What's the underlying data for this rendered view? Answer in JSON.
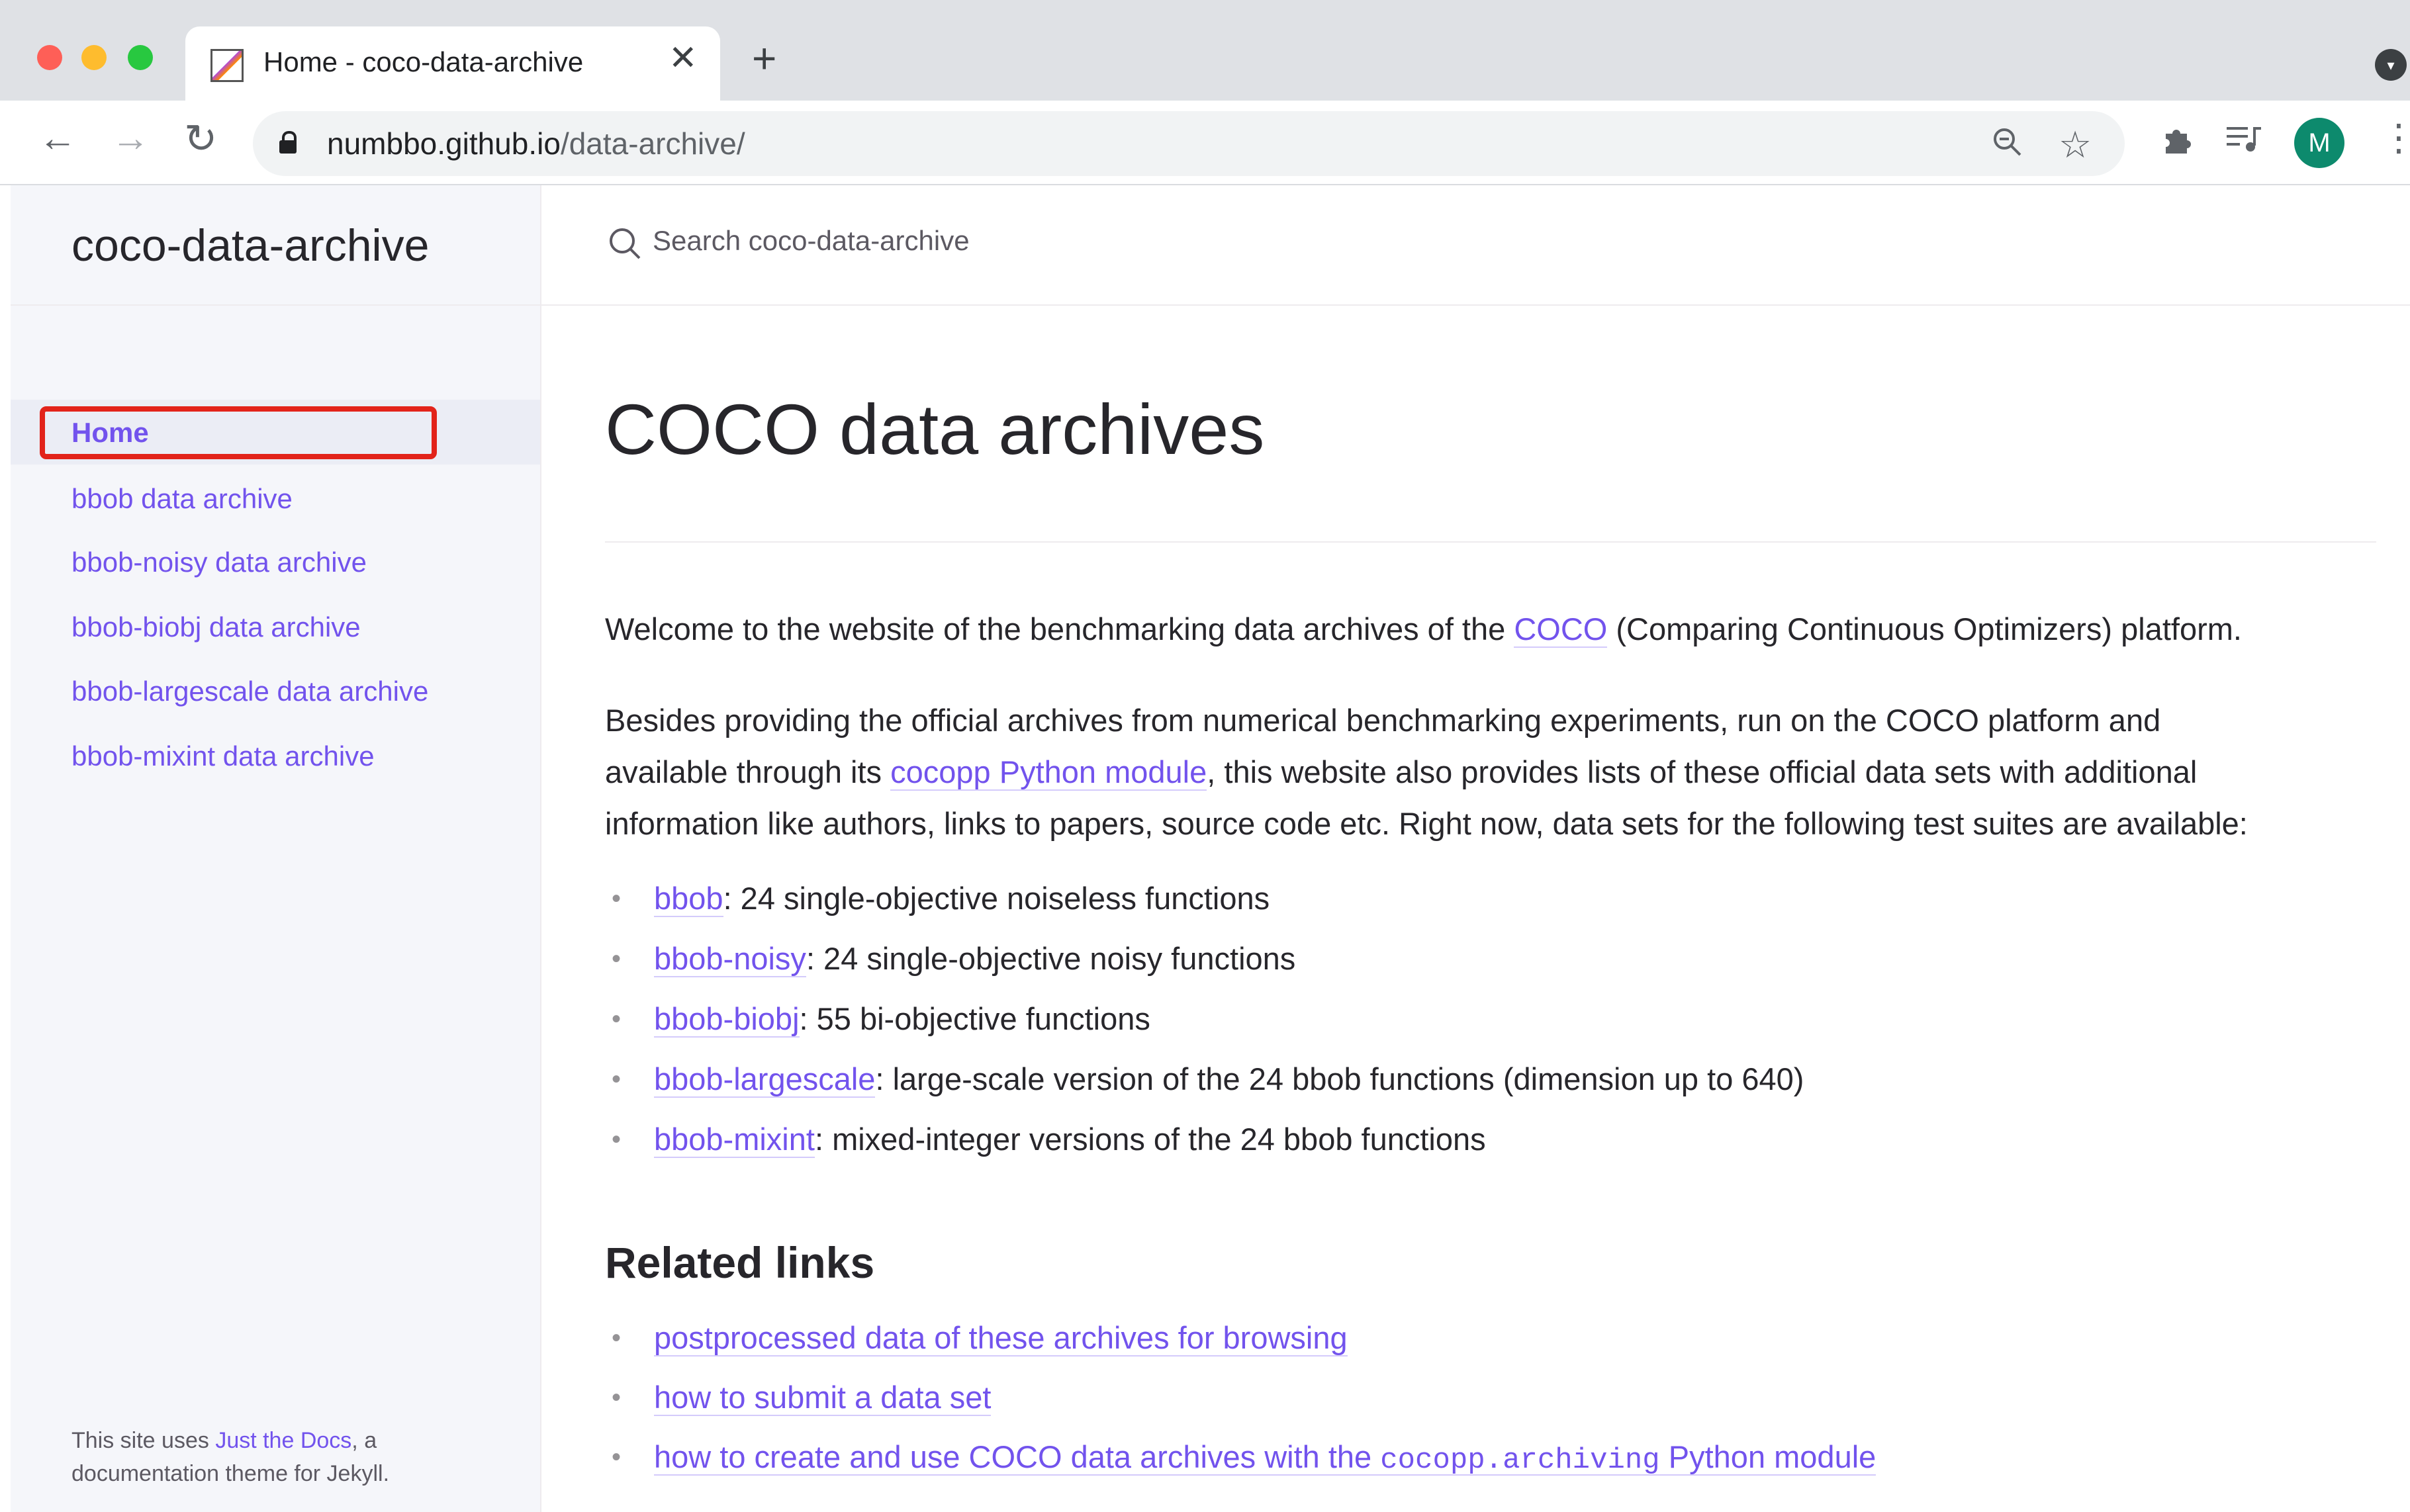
{
  "browser": {
    "tab_title": "Home - coco-data-archive",
    "close_glyph": "✕",
    "new_tab_glyph": "+",
    "url_host": "numbbo.github.io",
    "url_path": "/data-archive/",
    "avatar_letter": "M",
    "icons": [
      "back-arrow-icon",
      "forward-arrow-icon",
      "reload-icon",
      "lock-icon",
      "zoom-icon",
      "star-icon",
      "extensions-icon",
      "media-icon",
      "menu-icon"
    ]
  },
  "site": {
    "title": "coco-data-archive",
    "search_placeholder": "Search coco-data-archive"
  },
  "nav": {
    "home": "Home",
    "items": [
      "bbob data archive",
      "bbob-noisy data archive",
      "bbob-biobj data archive",
      "bbob-largescale data archive",
      "bbob-mixint data archive"
    ],
    "highlight_color": "#e2231a"
  },
  "footer": {
    "prefix": "This site uses ",
    "link": "Just the Docs",
    "suffix": ", a documentation theme for Jekyll."
  },
  "content": {
    "page_title": "COCO data archives",
    "intro_prefix": "Welcome to the website of the benchmarking data archives of the ",
    "intro_link": "COCO",
    "intro_suffix": " (Comparing Continuous Optimizers) platform.",
    "besides_line1": "Besides providing the official archives from numerical benchmarking experiments, run on the COCO platform and",
    "besides_line2_prefix": "available through its ",
    "besides_line2_link": "cocopp Python module",
    "besides_line2_suffix": ", this website also provides lists of these official data sets with additional",
    "besides_line3": "information like authors, links to papers, source code etc. Right now, data sets for the following test suites are available:",
    "suites": [
      {
        "name": "bbob",
        "desc": ": 24 single-objective noiseless functions"
      },
      {
        "name": "bbob-noisy",
        "desc": ": 24 single-objective noisy functions"
      },
      {
        "name": "bbob-biobj",
        "desc": ": 55 bi-objective functions"
      },
      {
        "name": "bbob-largescale",
        "desc": ": large-scale version of the 24 bbob functions (dimension up to 640)"
      },
      {
        "name": "bbob-mixint",
        "desc": ": mixed-integer versions of the 24 bbob functions"
      }
    ],
    "related_heading": "Related links",
    "related": {
      "postprocessed": "postprocessed data of these archives for browsing",
      "submit": "how to submit a data set",
      "archiving_prefix": "how to create and use COCO data archives with the ",
      "archiving_code": "cocopp.archiving",
      "archiving_suffix": " Python module"
    }
  },
  "colors": {
    "link": "#7253ed",
    "text": "#27262b",
    "sidebar_bg": "#f5f6fa"
  }
}
